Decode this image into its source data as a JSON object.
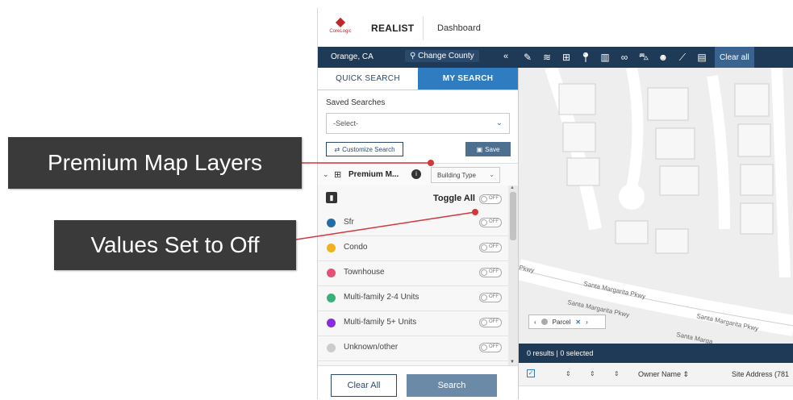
{
  "app": {
    "logo_text": "CoreLogic",
    "name": "REALIST",
    "nav_dashboard": "Dashboard"
  },
  "location": {
    "county": "Orange, CA",
    "change_county": "Change County",
    "collapse_glyph": "«"
  },
  "toolbar": {
    "tools": [
      "pencil-icon",
      "layers-icon",
      "grid-icon",
      "pin-icon",
      "chart-icon",
      "binoculars-icon",
      "car-icon",
      "people-icon",
      "ruler-icon",
      "comment-icon"
    ],
    "clear_all": "Clear all"
  },
  "panel": {
    "tabs": [
      {
        "label": "QUICK SEARCH",
        "active": false
      },
      {
        "label": "MY SEARCH",
        "active": true
      }
    ],
    "saved_searches_label": "Saved Searches",
    "saved_select_value": "-Select-",
    "customize_search": "Customize Search",
    "save": "Save"
  },
  "layers": {
    "title": "Premium M...",
    "filter_value": "Building Type",
    "toggle_all_label": "Toggle All",
    "switch_off_text": "OFF",
    "items": [
      {
        "label": "Sfr",
        "color": "#1f6fa6"
      },
      {
        "label": "Condo",
        "color": "#f2b11c"
      },
      {
        "label": "Townhouse",
        "color": "#e84f73"
      },
      {
        "label": "Multi-family 2-4 Units",
        "color": "#3bb07a"
      },
      {
        "label": "Multi-family 5+ Units",
        "color": "#8a2be2"
      },
      {
        "label": "Unknown/other",
        "color": "#cccccc"
      }
    ]
  },
  "actions": {
    "clear_all": "Clear All",
    "search": "Search"
  },
  "map": {
    "streets": [
      "Pkwy",
      "Santa Margarita Pkwy",
      "Santa Margarita Pkwy",
      "Santa Margarita Pkwy",
      "Santa Marga"
    ],
    "parcel_chip": "Parcel"
  },
  "results": {
    "summary": "0 results   |   0 selected",
    "columns": {
      "owner": "Owner Name ⇕",
      "site": "Site Address (781"
    }
  },
  "callouts": {
    "premium_layers": "Premium Map Layers",
    "values_off": "Values Set to Off"
  },
  "colors": {
    "navy": "#1f3a56",
    "accent": "#2f7cc1",
    "callout_bg": "#3a3a3a",
    "callout_line": "#d2373b"
  }
}
